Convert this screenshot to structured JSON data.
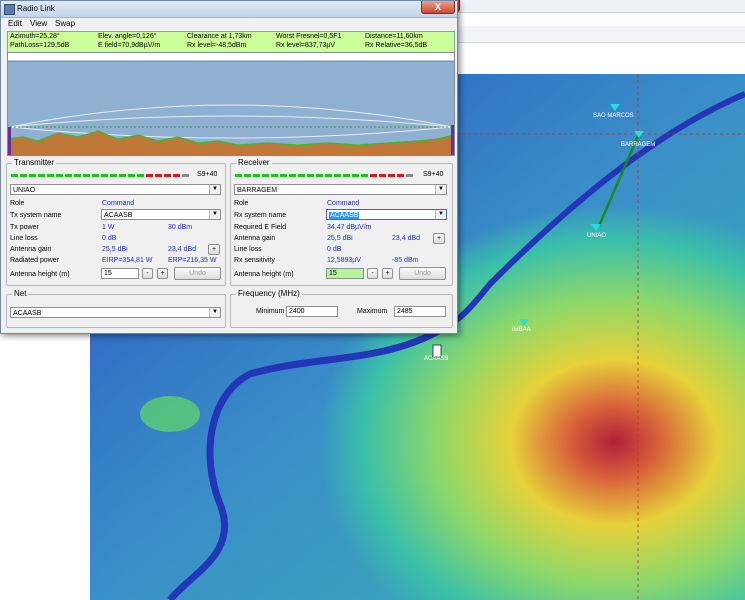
{
  "background_app": {
    "close_label": "X"
  },
  "map": {
    "labels": [
      {
        "id": "sao-marcos",
        "text": "SAO MARCOS"
      },
      {
        "id": "barragem",
        "text": "BARRAGEM"
      },
      {
        "id": "uniao",
        "text": "UNIAO"
      },
      {
        "id": "imbaa",
        "text": "IMBAA"
      },
      {
        "id": "acaasb",
        "text": "ACAASB"
      }
    ],
    "colors": {
      "low": "#2a55c8",
      "mid": "#3ac0a8",
      "high": "#e6d23a",
      "peak": "#b0203a",
      "link": "#1a8a20",
      "grid": "#c83030"
    }
  },
  "dialog": {
    "title": "Radio Link",
    "close_label": "X",
    "menu": [
      "Edit",
      "View",
      "Swap"
    ],
    "info": {
      "azimuth": "Azimuth=25,28°",
      "elev_angle": "Elev. angle=0,126°",
      "clearance": "Clearance at 1,73km",
      "worst_fresnel": "Worst Fresnel=0,5F1",
      "distance": "Distance=11,60km",
      "path_loss": "PathLoss=129,5dB",
      "e_field": "E field=70,9dBµV/m",
      "rx_level_db": "Rx level=-48,5dBm",
      "rx_level_uv": "Rx level=837,73µV",
      "rx_relative": "Rx Relative=36,5dB"
    },
    "transmitter": {
      "group_label": "Transmitter",
      "signal": "S9+40",
      "site": "UNIAO",
      "role_label": "Role",
      "role": "Command",
      "system_label": "Tx system name",
      "system": "ACAASB",
      "power_label": "Tx power",
      "power_w": "1 W",
      "power_dbm": "30 dBm",
      "line_loss_label": "Line loss",
      "line_loss": "0 dB",
      "gain_label": "Antenna gain",
      "gain_dbi": "25,5 dBi",
      "gain_dbd": "23,4 dBd",
      "radiated_label": "Radiated power",
      "eirp": "EIRP=354,81 W",
      "erp": "ERP=216,35 W",
      "height_label": "Antenna height (m)",
      "height": "15",
      "minus": "-",
      "plus": "+",
      "undo": "Undo"
    },
    "receiver": {
      "group_label": "Receiver",
      "signal": "S9+40",
      "site": "BARRAGEM",
      "role_label": "Role",
      "role": "Command",
      "system_label": "Rx system name",
      "system": "ACAASB",
      "req_label": "Required E Field",
      "req_value": "34,47 dBµV/m",
      "gain_label": "Antenna gain",
      "gain_dbi": "25,5 dBi",
      "gain_dbd": "23,4 dBd",
      "line_loss_label": "Line loss",
      "line_loss": "0 dB",
      "sens_label": "Rx sensitivity",
      "sens_uv": "12,5893µV",
      "sens_dbm": "-85 dBm",
      "height_label": "Antenna height (m)",
      "height": "15",
      "minus": "-",
      "plus": "+",
      "undo": "Undo"
    },
    "net": {
      "group_label": "Net",
      "value": "ACAASB"
    },
    "frequency": {
      "group_label": "Frequency (MHz)",
      "min_label": "Minimum",
      "min": "2400",
      "max_label": "Maximum",
      "max": "2485"
    }
  }
}
